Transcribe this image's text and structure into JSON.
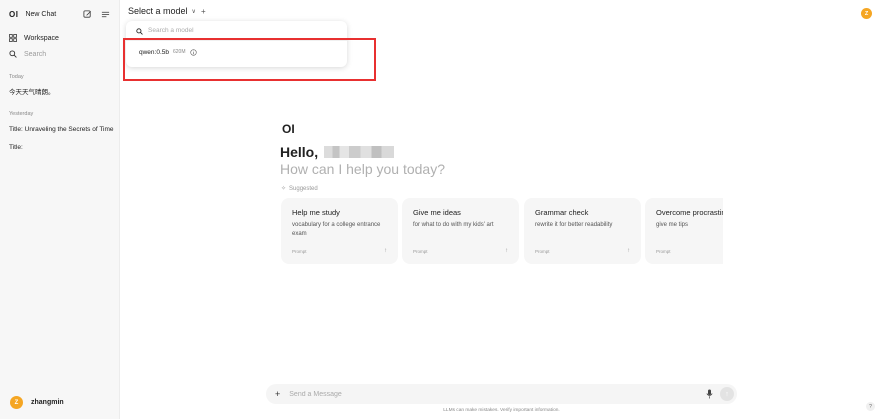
{
  "sidebar": {
    "logo": "OI",
    "new_chat": "New Chat",
    "workspace": "Workspace",
    "search": "Search",
    "sections": [
      {
        "label": "Today",
        "chats": [
          "今天天气晴朗。"
        ]
      },
      {
        "label": "Yesterday",
        "chats": [
          "Title: Unraveling the Secrets of Time",
          "Title:"
        ]
      }
    ],
    "user": {
      "initial": "Z",
      "name": "zhangmin"
    }
  },
  "header": {
    "model_select": "Select a model",
    "avatar_initial": "Z"
  },
  "dropdown": {
    "search_placeholder": "Search a model",
    "models": [
      {
        "name": "qwen:0.5b",
        "size": "620M"
      }
    ]
  },
  "welcome": {
    "logo": "OI",
    "greeting": "Hello,",
    "question": "How can I help you today?",
    "suggested_label": "Suggested"
  },
  "suggestions": [
    {
      "title": "Help me study",
      "subtitle": "vocabulary for a college entrance exam",
      "footer": "Prompt"
    },
    {
      "title": "Give me ideas",
      "subtitle": "for what to do with my kids' art",
      "footer": "Prompt"
    },
    {
      "title": "Grammar check",
      "subtitle": "rewrite it for better readability",
      "footer": "Prompt"
    },
    {
      "title": "Overcome procrastination",
      "subtitle": "give me tips",
      "footer": "Prompt"
    }
  ],
  "composer": {
    "placeholder": "Send a Message",
    "disclaimer": "LLMs can make mistakes. Verify important information."
  },
  "help": "?",
  "colors": {
    "avatar": "#f5a623",
    "highlight": "#e83030"
  }
}
